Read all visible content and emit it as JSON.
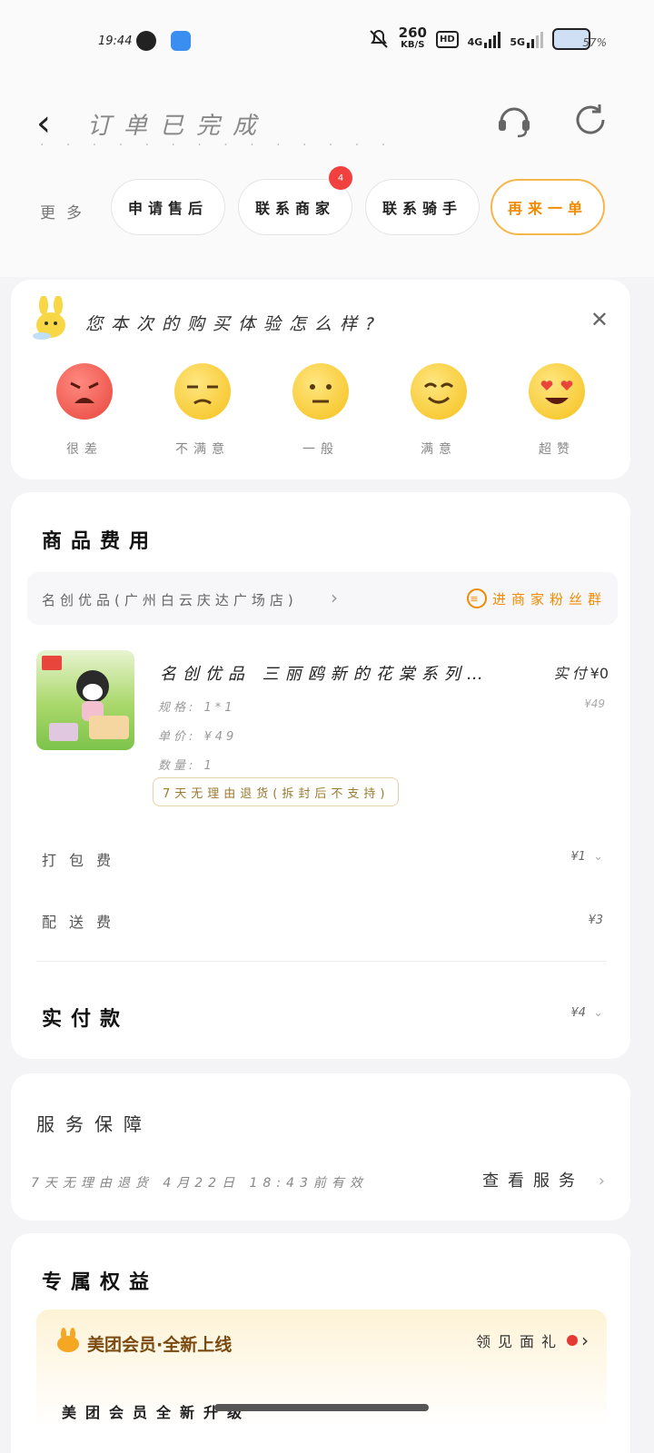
{
  "status_bar": {
    "time": "19:44",
    "net_speed": "260",
    "net_unit": "KB/S",
    "hd_label": "HD",
    "signal_4g": "4G",
    "signal_5g": "5G",
    "battery": "57%"
  },
  "header": {
    "title": "订单已完成",
    "more_label": "更多",
    "buttons": [
      {
        "label": "申请售后"
      },
      {
        "label": "联系商家"
      },
      {
        "label": "联系骑手"
      },
      {
        "label": "再来一单"
      }
    ],
    "badge": "4"
  },
  "survey": {
    "question": "您本次的购买体验怎么样?",
    "options": [
      {
        "label": "很差",
        "color": "#f0605a"
      },
      {
        "label": "不满意",
        "color": "#f5cc30"
      },
      {
        "label": "一般",
        "color": "#f5cc30"
      },
      {
        "label": "满意",
        "color": "#f5cc30"
      },
      {
        "label": "超赞",
        "color": "#f5cc30"
      }
    ]
  },
  "goods": {
    "section_title": "商品费用",
    "shop_name": "名创优品(广州白云庆达广场店)",
    "fans_label": "进商家粉丝群",
    "product": {
      "name": "名创优品 三丽鸥新的花棠系列…",
      "pay_label": "实付",
      "pay_value": "¥0",
      "orig_price": "¥49",
      "spec": "规格: 1*1",
      "unit_price": "单价: ¥49",
      "quantity": "数量: 1",
      "return_policy": "7天无理由退货(拆封后不支持)"
    },
    "fees": [
      {
        "label": "打包费",
        "value": "¥1"
      },
      {
        "label": "配送费",
        "value": "¥3"
      }
    ],
    "total_label": "实付款",
    "total_value": "¥4"
  },
  "service": {
    "title": "服务保障",
    "line": "7天无理由退货 4月22日 18:43前有效",
    "link": "查看服务"
  },
  "benefits": {
    "title": "专属权益",
    "member_title": "美团会员·全新上线",
    "member_link": "领见面礼",
    "member_sub": "美团会员全新升级"
  },
  "colors": {
    "accent": "#f08a00",
    "badge": "#f04040"
  }
}
